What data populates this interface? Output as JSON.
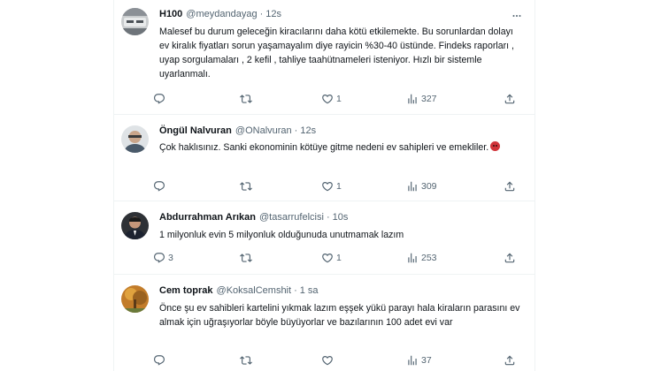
{
  "tweets": [
    {
      "name": "H100",
      "handle": "@meydandayag",
      "time": "12s",
      "text": "Malesef bu durum geleceğin kiracılarını daha kötü etkilemekte. Bu sorunlardan dolayı ev kiralık fiyatları sorun yaşamayalım diye rayicin %30-40 üstünde. Findeks raporları , uyap sorgulamaları , 2 kefil , tahliye taahütnameleri isteniyor. Hızlı bir sistemle uyarlanmalı.",
      "counts": {
        "reply": "",
        "retweet": "",
        "like": "1",
        "views": "327"
      }
    },
    {
      "name": "Öngül Nalvuran",
      "handle": "@ONalvuran",
      "time": "12s",
      "text": "Çok haklısınız. Sanki ekonominin kötüye gitme nedeni ev sahipleri ve emekliler.",
      "emoji": "angry-face-emoji",
      "counts": {
        "reply": "",
        "retweet": "",
        "like": "1",
        "views": "309"
      }
    },
    {
      "name": "Abdurrahman Arıkan",
      "handle": "@tasarrufelcisi",
      "time": "10s",
      "text": "1 milyonluk evin 5 milyonluk olduğunuda unutmamak lazım",
      "counts": {
        "reply": "3",
        "retweet": "",
        "like": "1",
        "views": "253"
      }
    },
    {
      "name": "Cem toprak",
      "handle": "@KoksalCemshit",
      "time": "1 sa",
      "text": "Önce şu ev sahibleri kartelini yıkmak lazım eşşek yükü parayı hala kiraların parasını ev almak için uğraşıyorlar böyle büyüyorlar ve bazılarının 100 adet evi var",
      "counts": {
        "reply": "",
        "retweet": "",
        "like": "",
        "views": "37"
      }
    }
  ],
  "separator": "·",
  "icons": {
    "more": "more-icon",
    "reply": "reply-icon",
    "retweet": "retweet-icon",
    "like": "like-icon",
    "views": "views-icon",
    "share": "share-icon"
  },
  "colors": {
    "text": "#0f1419",
    "muted": "#536471",
    "border": "#eff3f4",
    "emoji": "#d1343a"
  }
}
